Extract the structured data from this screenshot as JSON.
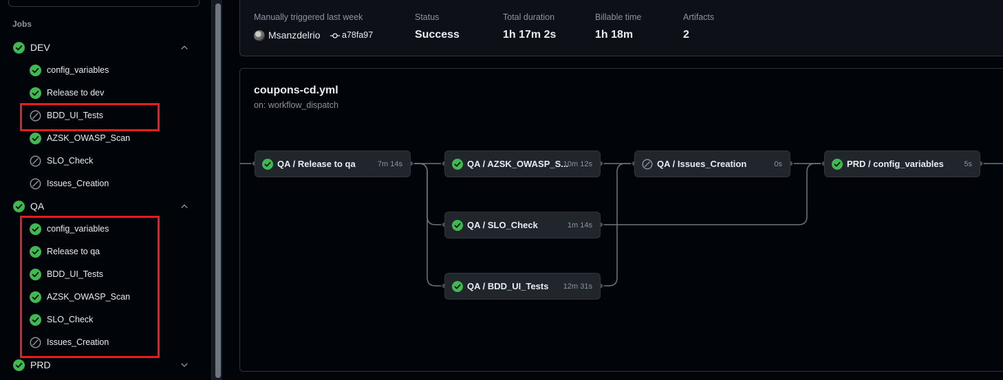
{
  "sidebar": {
    "jobs_heading": "Jobs",
    "groups": [
      {
        "label": "DEV",
        "status": "success",
        "expanded": true,
        "jobs": [
          {
            "label": "config_variables",
            "status": "success"
          },
          {
            "label": "Release to dev",
            "status": "success"
          },
          {
            "label": "BDD_UI_Tests",
            "status": "skipped"
          },
          {
            "label": "AZSK_OWASP_Scan",
            "status": "success"
          },
          {
            "label": "SLO_Check",
            "status": "skipped"
          },
          {
            "label": "Issues_Creation",
            "status": "skipped"
          }
        ]
      },
      {
        "label": "QA",
        "status": "success",
        "expanded": true,
        "jobs": [
          {
            "label": "config_variables",
            "status": "success"
          },
          {
            "label": "Release to qa",
            "status": "success"
          },
          {
            "label": "BDD_UI_Tests",
            "status": "success"
          },
          {
            "label": "AZSK_OWASP_Scan",
            "status": "success"
          },
          {
            "label": "SLO_Check",
            "status": "success"
          },
          {
            "label": "Issues_Creation",
            "status": "skipped"
          }
        ]
      },
      {
        "label": "PRD",
        "status": "success",
        "expanded": false,
        "jobs": []
      }
    ]
  },
  "summary": {
    "trigger_label": "Manually triggered last week",
    "actor": "Msanzdelrio",
    "commit": "a78fa97",
    "status_label": "Status",
    "status_value": "Success",
    "duration_label": "Total duration",
    "duration_value": "1h 17m 2s",
    "billable_label": "Billable time",
    "billable_value": "1h 18m",
    "artifacts_label": "Artifacts",
    "artifacts_value": "2"
  },
  "workflow": {
    "title": "coupons-cd.yml",
    "subtitle": "on: workflow_dispatch",
    "nodes": [
      {
        "label": "QA / Release to qa",
        "time": "7m 14s",
        "status": "success"
      },
      {
        "label": "QA / AZSK_OWASP_S...",
        "time": "10m 12s",
        "status": "success"
      },
      {
        "label": "QA / SLO_Check",
        "time": "1m 14s",
        "status": "success"
      },
      {
        "label": "QA / BDD_UI_Tests",
        "time": "12m 31s",
        "status": "success"
      },
      {
        "label": "QA / Issues_Creation",
        "time": "0s",
        "status": "skipped"
      },
      {
        "label": "PRD / config_variables",
        "time": "5s",
        "status": "success"
      }
    ]
  },
  "colors": {
    "success": "#3fb950",
    "skipped": "#8b949e",
    "highlight": "#ec1c1c"
  },
  "icons": {
    "success": "check-circle-icon",
    "skipped": "skip-circle-icon",
    "expanded": "chevron-up-icon",
    "collapsed": "chevron-down-icon",
    "commit": "git-commit-icon"
  }
}
